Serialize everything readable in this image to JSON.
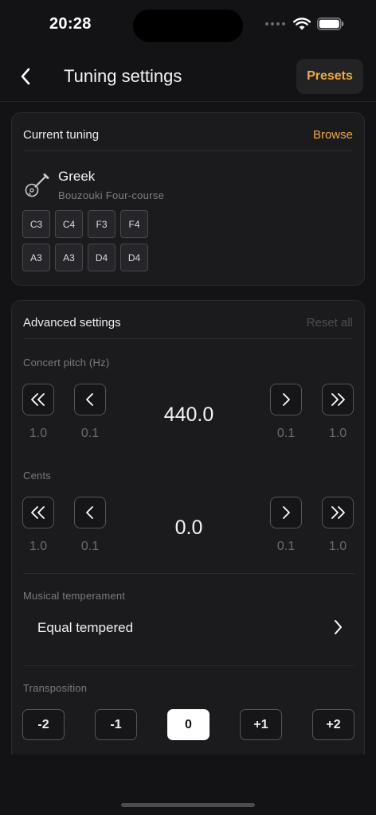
{
  "status": {
    "time": "20:28"
  },
  "nav": {
    "title": "Tuning settings",
    "presets_label": "Presets"
  },
  "current_tuning": {
    "title": "Current tuning",
    "browse_label": "Browse",
    "instrument_icon": "bouzouki-icon",
    "name": "Greek",
    "subtitle": "Bouzouki Four-course",
    "strings": [
      "C3",
      "C4",
      "F3",
      "F4",
      "A3",
      "A3",
      "D4",
      "D4"
    ]
  },
  "advanced": {
    "title": "Advanced settings",
    "reset_label": "Reset all",
    "concert_pitch": {
      "label": "Concert pitch (Hz)",
      "value": "440.0",
      "steps": [
        "1.0",
        "0.1",
        "0.1",
        "1.0"
      ]
    },
    "cents": {
      "label": "Cents",
      "value": "0.0",
      "steps": [
        "1.0",
        "0.1",
        "0.1",
        "1.0"
      ]
    },
    "temperament": {
      "label": "Musical temperament",
      "value": "Equal tempered"
    },
    "transposition": {
      "label": "Transposition",
      "options": [
        "-2",
        "-1",
        "0",
        "+1",
        "+2"
      ],
      "selected": "0"
    }
  },
  "colors": {
    "accent": "#f0ab3c",
    "background": "#131315",
    "card": "#1b1b1d"
  }
}
